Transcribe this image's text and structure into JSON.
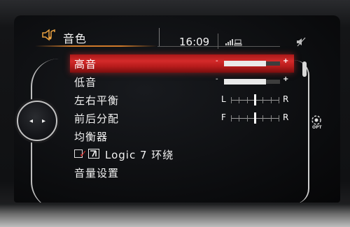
{
  "header": {
    "title": "音色",
    "title_icon": "speaker-note-icon",
    "clock": "16:09",
    "status_icon": "signal-phone-icon",
    "right_icon": "mute-speaker-icon"
  },
  "controller": {
    "icon": "controller-knob-icon",
    "left_arrow": "◂",
    "right_arrow": "▸"
  },
  "options_button": {
    "icon": "options-icon",
    "label": "OPT"
  },
  "menu": {
    "items": [
      {
        "label": "高音",
        "type": "slider",
        "minus": "-",
        "plus": "+",
        "value": 0.75,
        "selected": true
      },
      {
        "label": "低音",
        "type": "slider",
        "minus": "-",
        "plus": "+",
        "value": 0.75,
        "selected": false
      },
      {
        "label": "左右平衡",
        "type": "balance",
        "left_label": "L",
        "right_label": "R",
        "value": 0.5
      },
      {
        "label": "前后分配",
        "type": "balance",
        "left_label": "F",
        "right_label": "R",
        "value": 0.5
      },
      {
        "label": "均衡器",
        "type": "link"
      },
      {
        "label": "Logic 7 环绕",
        "type": "checkbox",
        "checked": true,
        "icon": "logic7-icon"
      },
      {
        "label": "音量设置",
        "type": "link"
      }
    ]
  },
  "colors": {
    "accent_red": "#d42a2a",
    "header_orange": "#d07a2a",
    "text": "#f2f2f2"
  }
}
